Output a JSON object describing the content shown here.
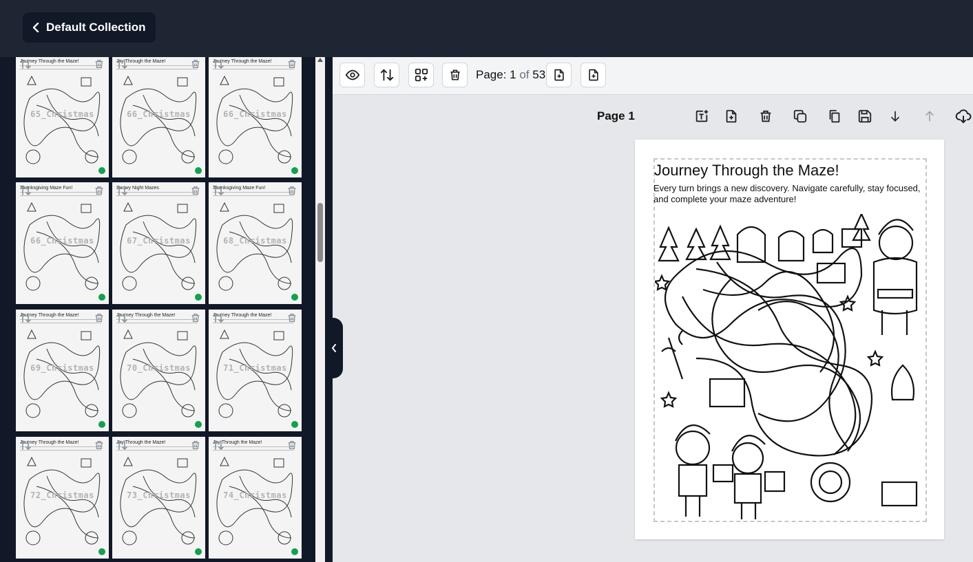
{
  "header": {
    "back_label": "Default Collection"
  },
  "toolbar": {
    "page_prefix": "Page: ",
    "current_page": "1",
    "of_label": " of ",
    "total_pages": "53"
  },
  "page": {
    "label": "Page 1",
    "title": "Journey Through the Maze!",
    "description": "Every turn brings a new discovery. Navigate carefully, stay focused, and complete your maze adventure!"
  },
  "thumbnails": [
    {
      "title": "Journey Through the Maze!",
      "name": "65_Christmas"
    },
    {
      "title": "Joy Through the Maze!",
      "name": "66_Christmas"
    },
    {
      "title": "Journey Through the Maze!",
      "name": "66_Christmas"
    },
    {
      "title": "Thanksgiving Maze Fun!",
      "name": "66_Christmas"
    },
    {
      "title": "Snowy Night Mazes",
      "name": "67_Christmas"
    },
    {
      "title": "Thanksgiving Maze Fun!",
      "name": "68_Christmas"
    },
    {
      "title": "Journey Through the Maze!",
      "name": "69_Christmas"
    },
    {
      "title": "Journey Through the Maze!",
      "name": "70_Christmas"
    },
    {
      "title": "Journey Through the Maze!",
      "name": "71_Christmas"
    },
    {
      "title": "Journey Through the Maze!",
      "name": "72_Christmas"
    },
    {
      "title": "Joy Through the Maze!",
      "name": "73_Christmas"
    },
    {
      "title": "Joy Through the Maze!",
      "name": "74_Christmas"
    }
  ],
  "colors": {
    "status_dot": "#12a150",
    "sidebar_bg": "#111827",
    "topbar_bg": "#1e2533"
  }
}
